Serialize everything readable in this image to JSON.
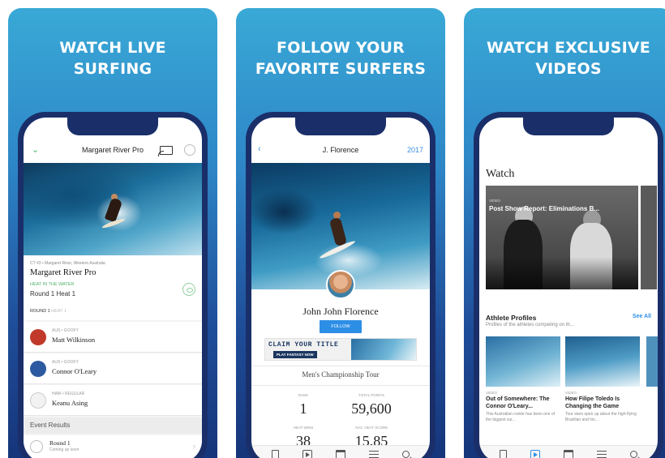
{
  "colors": {
    "accent_blue": "#2d8ee6",
    "heat_green": "#4fb06b",
    "panel_top": "#39a9d6",
    "panel_bottom": "#16357a"
  },
  "panels": [
    {
      "headline": "WATCH LIVE\nSURFING"
    },
    {
      "headline": "FOLLOW YOUR\nFAVORITE SURFERS"
    },
    {
      "headline": "WATCH EXCLUSIVE\nVIDEOS"
    }
  ],
  "phone1": {
    "nav_title": "Margaret River Pro",
    "event_meta": "CT #3 • Margaret River, Western Australia",
    "event_title": "Margaret River Pro",
    "heat_label": "HEAT IN THE WATER",
    "heat_value": "Round 1 Heat 1",
    "round_active": "ROUND 1",
    "round_inactive": "HEAT 1",
    "athletes": [
      {
        "meta": "AUS • GOOFY",
        "name": "Matt Wilkinson",
        "color": "#c0392b"
      },
      {
        "meta": "AUS • GOOFY",
        "name": "Connor O'Leary",
        "color": "#2c5aa0"
      },
      {
        "meta": "HAW • REGULAR",
        "name": "Keanu Asing",
        "color": "#f2f2f2"
      }
    ],
    "section_title": "Event Results",
    "round_row": {
      "name": "Round 1",
      "status": "Coming up soon"
    }
  },
  "phone2": {
    "nav_title": "J. Florence",
    "year": "2017",
    "profile_name": "John John Florence",
    "follow_label": "FOLLOW",
    "banner_title": "CLAIM YOUR TITLE",
    "banner_sub": "PLAY FANTASY NOW",
    "tour_title": "Men's Championship Tour",
    "stats": [
      {
        "label": "RANK",
        "value": "1"
      },
      {
        "label": "TOTAL POINTS",
        "value": "59,600"
      },
      {
        "label": "HEAT WINS",
        "value": "38"
      },
      {
        "label": "AVG. HEAT SCORE",
        "value": "15.85"
      }
    ]
  },
  "phone3": {
    "page_title": "Watch",
    "featured": {
      "tag": "VIDEO",
      "title": "Post Show Report: Eliminations B..."
    },
    "section_title": "Athlete Profiles",
    "see_all": "See All",
    "section_sub": "Profiles of the athletes competing on th...",
    "cards": [
      {
        "tag": "VIDEO",
        "title": "Out of Somewhere: The Connor O'Leary...",
        "desc": "This Australian rookie has been one of the biggest sur..."
      },
      {
        "tag": "VIDEO",
        "title": "How Filipe Toledo Is Changing the Game",
        "desc": "Tour stars open up about the high-flying Brazilian and his..."
      }
    ]
  },
  "tabbar_icons": [
    "bookmark-icon",
    "play-icon",
    "calendar-icon",
    "list-icon",
    "search-icon"
  ]
}
